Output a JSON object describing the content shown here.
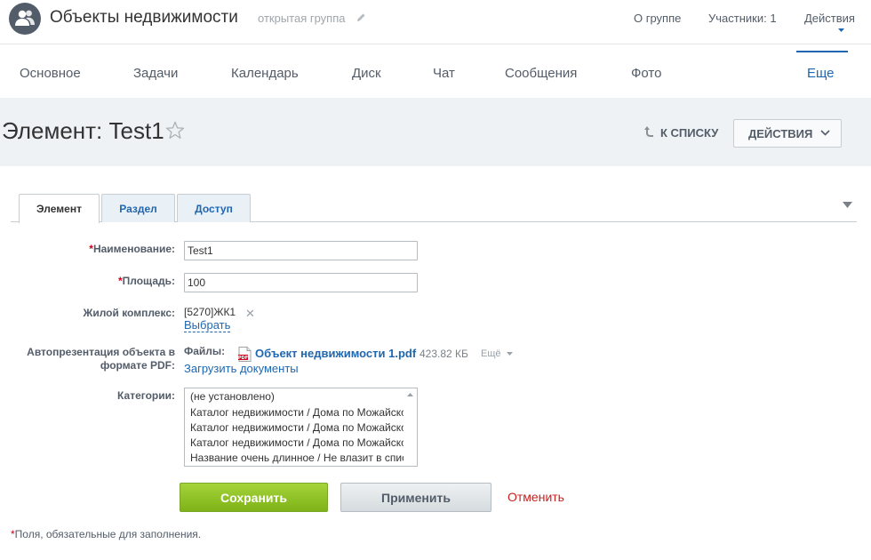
{
  "header": {
    "group_title": "Объекты недвижимости",
    "group_type": "открытая группа",
    "links": [
      "О группе",
      "Участники: 1",
      "Действия"
    ]
  },
  "nav": {
    "items": [
      "Основное",
      "Задачи",
      "Календарь",
      "Диск",
      "Чат",
      "Сообщения",
      "Фото"
    ],
    "more": "Еще"
  },
  "title_bar": {
    "title": "Элемент: Test1",
    "back_label": "К списку",
    "actions_label": "ДЕЙСТВИЯ"
  },
  "tabs": [
    "Элемент",
    "Раздел",
    "Доступ"
  ],
  "form": {
    "required_mark": "*",
    "name_label": "Наименование:",
    "name_value": "Test1",
    "area_label": "Площадь:",
    "area_value": "100",
    "complex_label": "Жилой комплекс:",
    "complex_value": "[5270]ЖК1",
    "complex_select": "Выбрать",
    "pdf_label_line1": "Автопрезентация объекта в",
    "pdf_label_line2": "формате PDF:",
    "files_label": "Файлы:",
    "file_name": "Объект недвижимости 1.pdf",
    "file_size": "423.82 КБ",
    "file_more": "Ещё",
    "upload_label": "Загрузить документы",
    "categories_label": "Категории:",
    "categories": [
      "(не установлено)",
      "Каталог недвижимости / Дома по Можайскому шоссе",
      "Каталог недвижимости / Дома по Можайскому шоссе",
      "Каталог недвижимости / Дома по Можайскому шоссе",
      "Название очень длинное / Не влазит в список"
    ]
  },
  "buttons": {
    "save": "Сохранить",
    "apply": "Применить",
    "cancel": "Отменить"
  },
  "footnote": "Поля, обязательные для заполнения.",
  "colors": {
    "accent": "#2067b0",
    "save_green": "#8cc227",
    "cancel_red": "#c8201d",
    "required_red": "#d0021b"
  }
}
